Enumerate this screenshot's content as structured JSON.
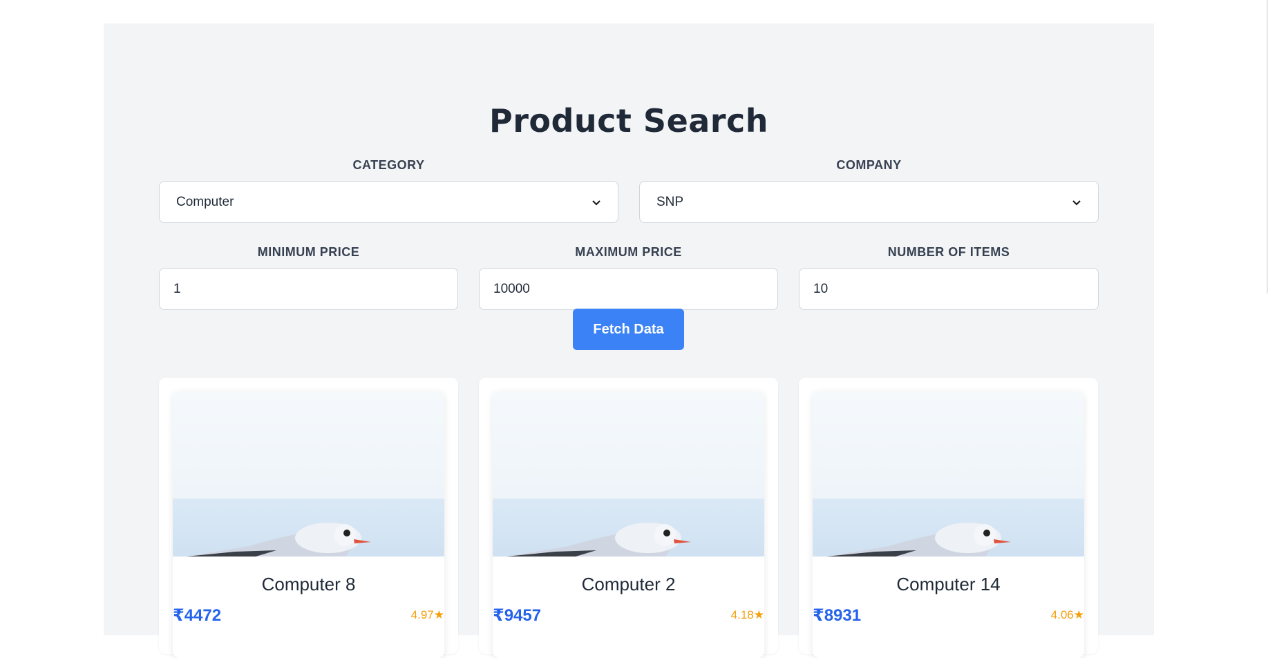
{
  "page": {
    "title": "Product Search"
  },
  "filters": {
    "category": {
      "label": "CATEGORY",
      "value": "Computer"
    },
    "company": {
      "label": "COMPANY",
      "value": "SNP"
    },
    "min_price": {
      "label": "MINIMUM PRICE",
      "value": "1"
    },
    "max_price": {
      "label": "MAXIMUM PRICE",
      "value": "10000"
    },
    "num_items": {
      "label": "NUMBER OF ITEMS",
      "value": "10"
    }
  },
  "actions": {
    "fetch_label": "Fetch Data"
  },
  "products": [
    {
      "name": "Computer 8",
      "price": "₹4472",
      "rating": "4.97★"
    },
    {
      "name": "Computer 2",
      "price": "₹9457",
      "rating": "4.18★"
    },
    {
      "name": "Computer 14",
      "price": "₹8931",
      "rating": "4.06★"
    }
  ],
  "colors": {
    "accent": "#3b82f6",
    "price": "#2563eb",
    "rating": "#f59e0b",
    "panel": "#f3f4f6"
  }
}
